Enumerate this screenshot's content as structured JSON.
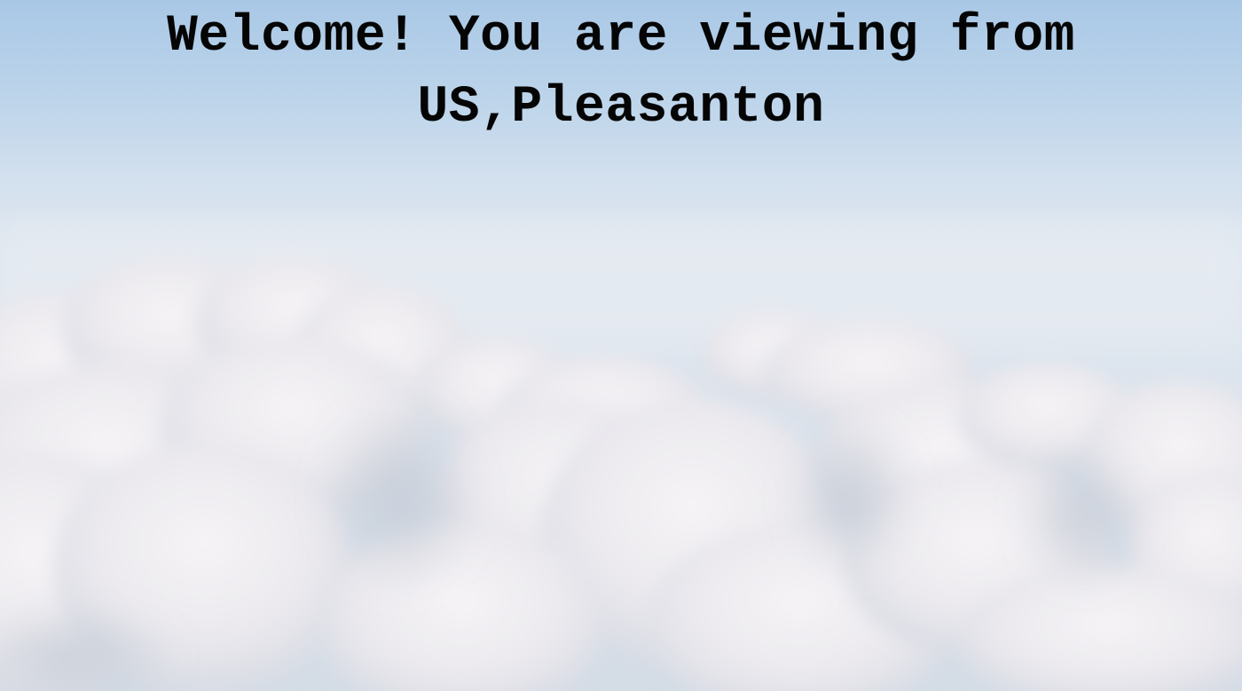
{
  "page": {
    "welcome_line1": "Welcome! You are viewing from",
    "welcome_line2": "US,Pleasanton"
  },
  "background": {
    "image": "sky-with-clouds",
    "sky_top_color": "#a9c8e6",
    "sky_mid_color": "#e1e8f0",
    "cloud_color": "#f2f0f2",
    "cloud_shadow_color": "#c9ced8"
  }
}
